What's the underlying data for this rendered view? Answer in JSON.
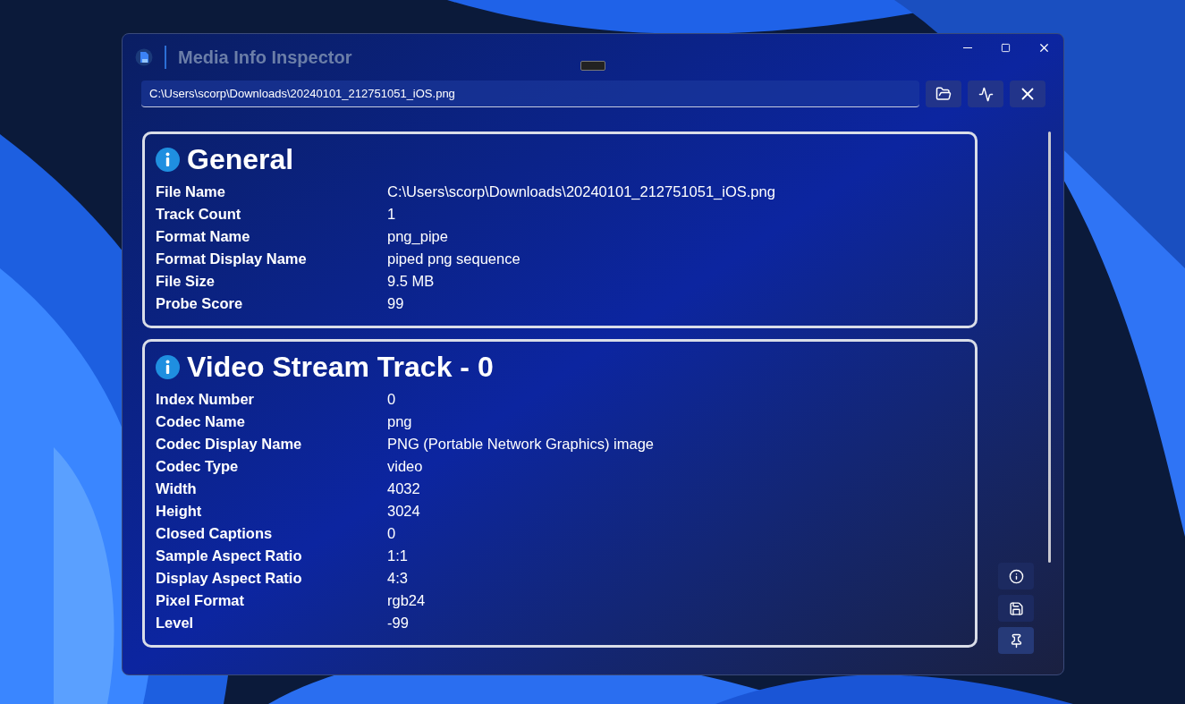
{
  "window": {
    "title": "Media Info Inspector"
  },
  "path_field": {
    "value": "C:\\Users\\scorp\\Downloads\\20240101_212751051_iOS.png"
  },
  "sections": [
    {
      "title": "General",
      "rows": [
        {
          "label": "File Name",
          "value": "C:\\Users\\scorp\\Downloads\\20240101_212751051_iOS.png"
        },
        {
          "label": "Track Count",
          "value": "1"
        },
        {
          "label": "Format Name",
          "value": "png_pipe"
        },
        {
          "label": "Format Display Name",
          "value": "piped png sequence"
        },
        {
          "label": "File Size",
          "value": "9.5 MB"
        },
        {
          "label": "Probe Score",
          "value": "99"
        }
      ]
    },
    {
      "title": "Video Stream Track - 0",
      "rows": [
        {
          "label": "Index Number",
          "value": "0"
        },
        {
          "label": "Codec Name",
          "value": "png"
        },
        {
          "label": "Codec Display Name",
          "value": "PNG (Portable Network Graphics) image"
        },
        {
          "label": "Codec Type",
          "value": "video"
        },
        {
          "label": "Width",
          "value": "4032"
        },
        {
          "label": "Height",
          "value": "3024"
        },
        {
          "label": "Closed Captions",
          "value": "0"
        },
        {
          "label": "Sample Aspect Ratio",
          "value": "1:1"
        },
        {
          "label": "Display Aspect Ratio",
          "value": "4:3"
        },
        {
          "label": "Pixel Format",
          "value": "rgb24"
        },
        {
          "label": "Level",
          "value": "-99"
        }
      ]
    }
  ]
}
